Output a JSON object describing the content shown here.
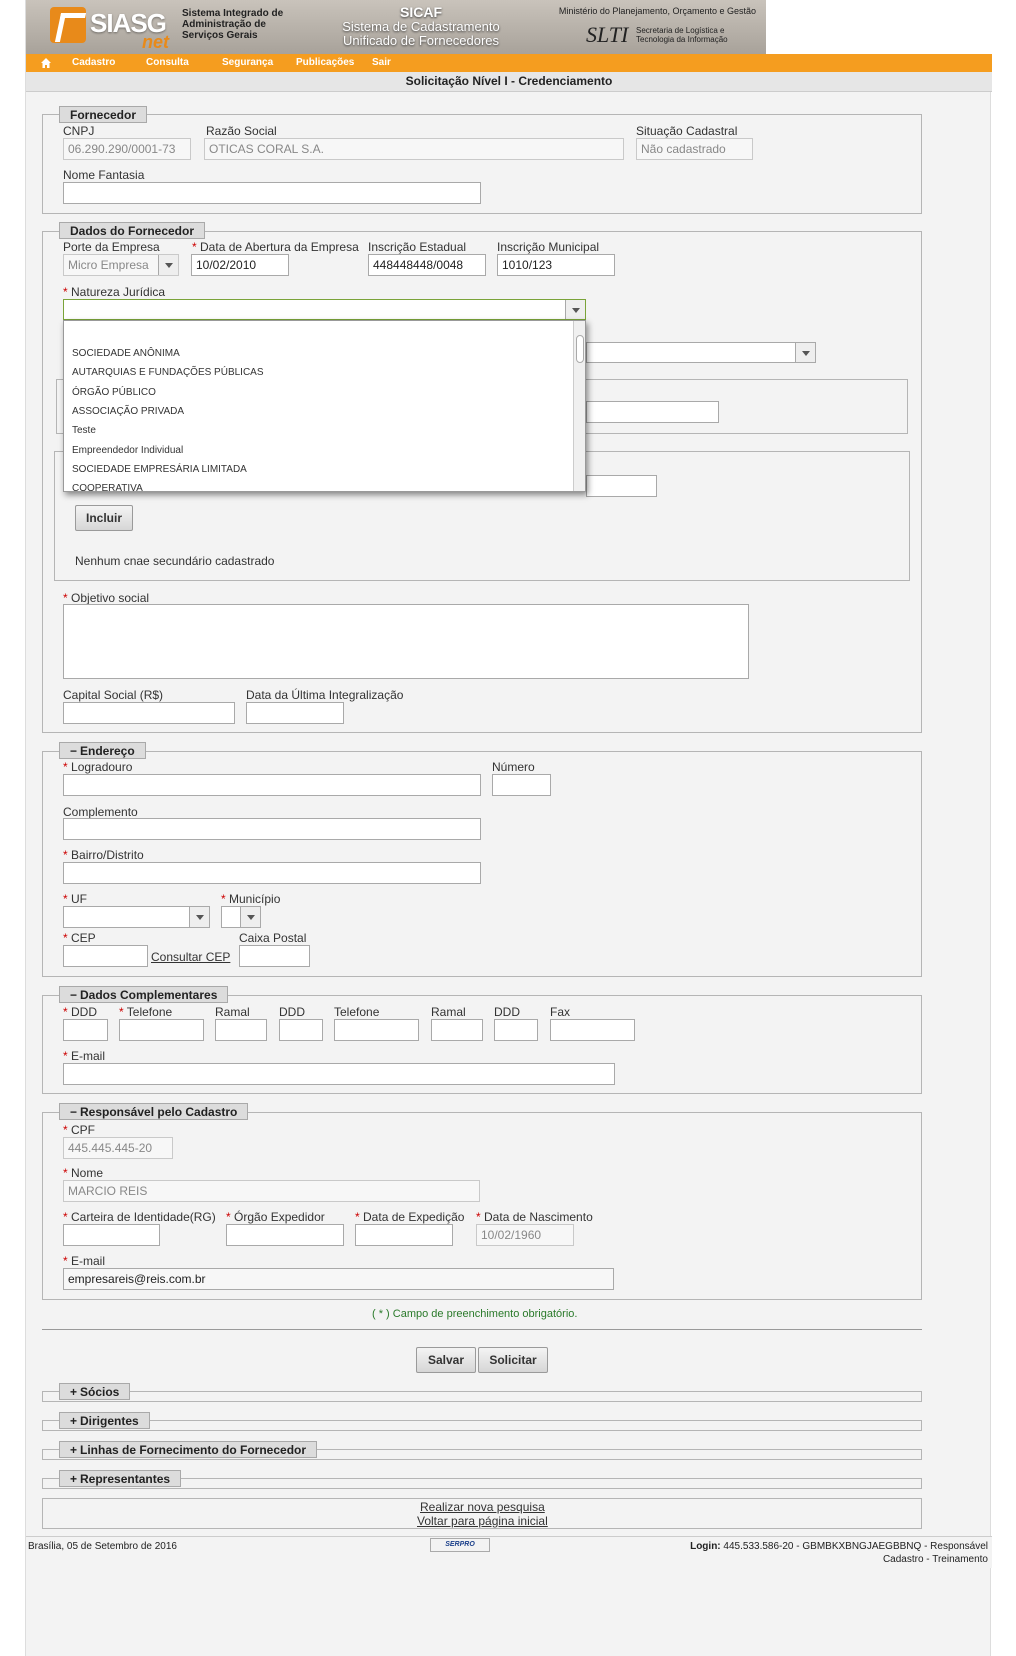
{
  "header": {
    "logo_text": "SIASG",
    "logo_sub": "net",
    "system_name": "Sistema Integrado de Administração de Serviços Gerais",
    "sicaf": "SICAF",
    "sicaf_sub": "Sistema de Cadastramento Unificado de Fornecedores",
    "ministry": "Ministério do Planejamento, Orçamento e Gestão",
    "slti": "SLTI",
    "slti_sub": "Secretaria de Logística e Tecnologia da Informação"
  },
  "nav": {
    "items": [
      "Cadastro",
      "Consulta",
      "Segurança",
      "Publicações",
      "Sair"
    ]
  },
  "page_title": "Solicitação Nível I - Credenciamento",
  "fornecedor": {
    "legend": "Fornecedor",
    "cnpj_label": "CNPJ",
    "cnpj_value": "06.290.290/0001-73",
    "razao_label": "Razão Social",
    "razao_value": "OTICAS CORAL S.A.",
    "situacao_label": "Situação Cadastral",
    "situacao_value": "Não cadastrado",
    "fantasia_label": "Nome Fantasia",
    "fantasia_value": ""
  },
  "dados_fornecedor": {
    "legend": "Dados do Fornecedor",
    "porte_label": "Porte da Empresa",
    "porte_value": "Micro Empresa",
    "abertura_label": "Data de Abertura da Empresa",
    "abertura_value": "10/02/2010",
    "estadual_label": "Inscrição Estadual",
    "estadual_value": "448448448/0048",
    "municipal_label": "Inscrição Municipal",
    "municipal_value": "1010/123",
    "natureza_label": "Natureza Jurídica",
    "natureza_value": "",
    "natureza_options": [
      "SOCIEDADE ANÔNIMA",
      "AUTARQUIAS E FUNDAÇÕES PÚBLICAS",
      "ÓRGÃO PÚBLICO",
      "ASSOCIAÇÃO PRIVADA",
      "Teste",
      "Empreendedor Individual",
      "SOCIEDADE EMPRESÁRIA LIMITADA",
      "COOPERATIVA"
    ],
    "incluir_label": "Incluir",
    "cnae_empty": "Nenhum cnae secundário cadastrado",
    "objetivo_label": "Objetivo social",
    "capital_label": "Capital Social (R$)",
    "integralizacao_label": "Data da Última Integralização"
  },
  "endereco": {
    "legend": "Endereço",
    "logradouro_label": "Logradouro",
    "numero_label": "Número",
    "complemento_label": "Complemento",
    "bairro_label": "Bairro/Distrito",
    "uf_label": "UF",
    "municipio_label": "Município",
    "cep_label": "CEP",
    "consultar_cep": "Consultar CEP",
    "caixa_label": "Caixa Postal"
  },
  "complementares": {
    "legend": "Dados Complementares",
    "ddd1": "DDD",
    "telefone1": "Telefone",
    "ramal1": "Ramal",
    "ddd2": "DDD",
    "telefone2": "Telefone",
    "ramal2": "Ramal",
    "ddd3": "DDD",
    "fax": "Fax",
    "email_label": "E-mail"
  },
  "responsavel": {
    "legend": "Responsável pelo Cadastro",
    "cpf_label": "CPF",
    "cpf_value": "445.445.445-20",
    "nome_label": "Nome",
    "nome_value": "MARCIO REIS",
    "rg_label": "Carteira de Identidade(RG)",
    "orgao_label": "Órgão Expedidor",
    "expedicao_label": "Data de Expedição",
    "nascimento_label": "Data de Nascimento",
    "nascimento_value": "10/02/1960",
    "email_label": "E-mail",
    "email_value": "empresareis@reis.com.br"
  },
  "required_note": "( * ) Campo de preenchimento obrigatório.",
  "actions": {
    "salvar": "Salvar",
    "solicitar": "Solicitar"
  },
  "collapsed_sections": [
    "Sócios",
    "Dirigentes",
    "Linhas de Fornecimento do Fornecedor",
    "Representantes"
  ],
  "links": {
    "nova_pesquisa": "Realizar nova pesquisa",
    "voltar": "Voltar para página inicial"
  },
  "footer": {
    "date": "Brasília, 05 de Setembro de 2016",
    "serpro": "SERPRO",
    "login_label": "Login:",
    "login_value": "445.533.586-20 - GBMBKXBNGJAEGBBNQ - Responsável",
    "login_line2": "Cadastro - Treinamento"
  },
  "colors": {
    "nav": "#f59d1f",
    "required": "#cc0000",
    "note": "#2a7a2a"
  }
}
